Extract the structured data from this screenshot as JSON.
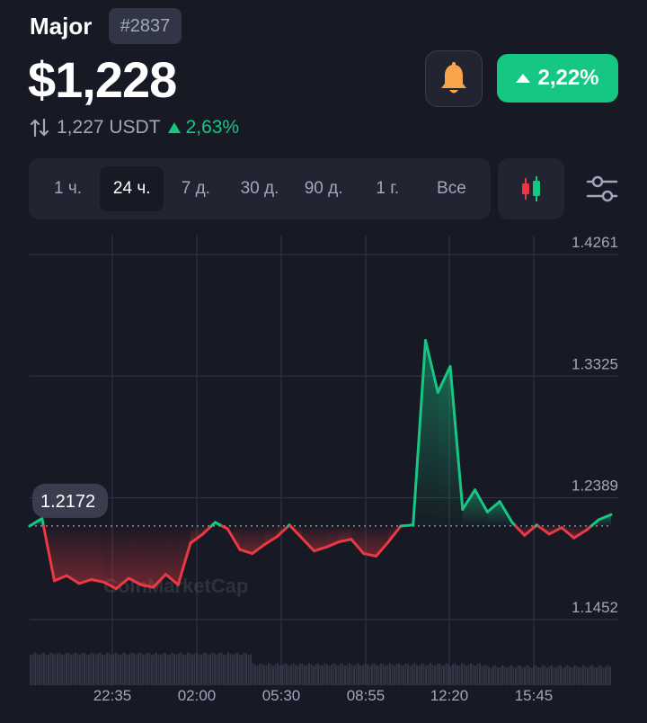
{
  "header": {
    "coin_name": "Major",
    "rank": "#2837",
    "price": "$1,228",
    "change_24h": "2,22%",
    "price_usdt": "1,227 USDT",
    "usdt_change": "2,63%"
  },
  "timeframes": [
    {
      "label": "1 ч.",
      "active": false
    },
    {
      "label": "24 ч.",
      "active": true
    },
    {
      "label": "7 д.",
      "active": false
    },
    {
      "label": "30 д.",
      "active": false
    },
    {
      "label": "90 д.",
      "active": false
    },
    {
      "label": "1 г.",
      "active": false
    },
    {
      "label": "Все",
      "active": false
    }
  ],
  "icons": {
    "bell": "bell-icon",
    "candles": "candlestick-icon",
    "filter": "sliders-icon",
    "swap": "swap-arrows-icon"
  },
  "colors": {
    "up": "#16c784",
    "down": "#ea3943",
    "background": "#171924",
    "panel": "#222531",
    "bell": "#f7a54a"
  },
  "chart_data": {
    "type": "line",
    "watermark": "CoinMarketCap",
    "y_ticks": [
      "1.4261",
      "1.3325",
      "1.2389",
      "1.1452"
    ],
    "x_ticks": [
      "22:35",
      "02:00",
      "05:30",
      "08:55",
      "12:20",
      "15:45"
    ],
    "baseline": 1.2172,
    "baseline_label": "1.2172",
    "ylim": [
      1.1452,
      1.4261
    ],
    "x": [
      "21:00",
      "21:30",
      "22:00",
      "22:30",
      "23:00",
      "23:30",
      "00:00",
      "00:30",
      "01:00",
      "01:30",
      "02:00",
      "02:30",
      "03:00",
      "03:30",
      "04:00",
      "04:30",
      "05:00",
      "05:30",
      "06:00",
      "06:30",
      "07:00",
      "07:30",
      "08:00",
      "08:30",
      "09:00",
      "09:30",
      "10:00",
      "10:30",
      "11:00",
      "11:30",
      "12:00",
      "12:30",
      "13:00",
      "13:30",
      "14:00",
      "14:30",
      "15:00",
      "15:30",
      "16:00",
      "16:30",
      "17:00",
      "17:30",
      "18:00",
      "18:30",
      "19:00",
      "19:30",
      "20:00",
      "20:30"
    ],
    "values": [
      1.2172,
      1.223,
      1.175,
      1.179,
      1.173,
      1.176,
      1.174,
      1.169,
      1.177,
      1.172,
      1.17,
      1.18,
      1.172,
      1.204,
      1.211,
      1.22,
      1.215,
      1.199,
      1.196,
      1.203,
      1.209,
      1.218,
      1.208,
      1.198,
      1.201,
      1.205,
      1.207,
      1.196,
      1.194,
      1.205,
      1.2172,
      1.218,
      1.36,
      1.32,
      1.34,
      1.23,
      1.245,
      1.228,
      1.236,
      1.22,
      1.21,
      1.218,
      1.211,
      1.216,
      1.208,
      1.214,
      1.222,
      1.226
    ],
    "volume_range": "low"
  }
}
